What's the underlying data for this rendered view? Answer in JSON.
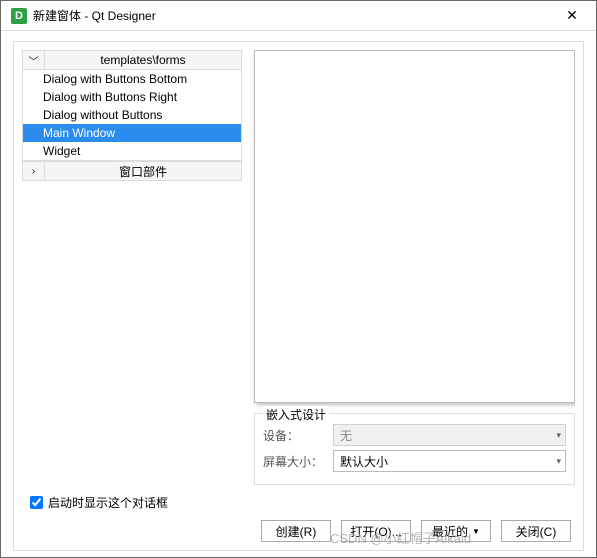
{
  "title": "新建窗体 - Qt Designer",
  "app_icon_letter": "D",
  "tree": {
    "header1": "templates\\forms",
    "header2": "窗口部件",
    "items": [
      "Dialog with Buttons Bottom",
      "Dialog with Buttons Right",
      "Dialog without Buttons",
      "Main Window",
      "Widget"
    ],
    "selected_index": 3
  },
  "embed": {
    "legend": "嵌入式设计",
    "device_label": "设备：",
    "device_value": "无",
    "size_label": "屏幕大小：",
    "size_value": "默认大小"
  },
  "checkbox_label": "启动时显示这个对话框",
  "checkbox_checked": true,
  "buttons": {
    "create": "创建(R)",
    "open": "打开(O)...",
    "recent": "最近的",
    "close": "关闭(C)"
  },
  "watermark": "CSDN @小红帽子Alkaid"
}
